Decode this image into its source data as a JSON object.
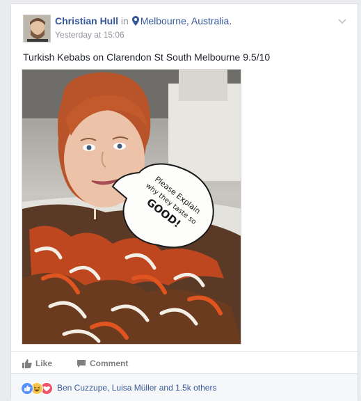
{
  "post": {
    "author": "Christian Hull",
    "connector": "in",
    "location": "Melbourne, Australia.",
    "timestamp": "Yesterday at 15:06",
    "text": "Turkish Kebabs on Clarendon St South Melbourne 9.5/10",
    "photo": {
      "speech_bubble_lines": [
        "Please Explain",
        "why they taste so",
        "GOOD!"
      ]
    }
  },
  "actions": {
    "like_label": "Like",
    "comment_label": "Comment"
  },
  "reactions": {
    "summary": "Ben Cuzzupe, Luisa Müller and 1.5k others",
    "icons": [
      "like-reaction-icon",
      "haha-reaction-icon",
      "love-reaction-icon"
    ]
  },
  "colors": {
    "link": "#365899",
    "meta": "#90949c",
    "like_blue": "#5890ff",
    "love_red": "#f25268",
    "haha_yellow": "#f7c54f"
  }
}
